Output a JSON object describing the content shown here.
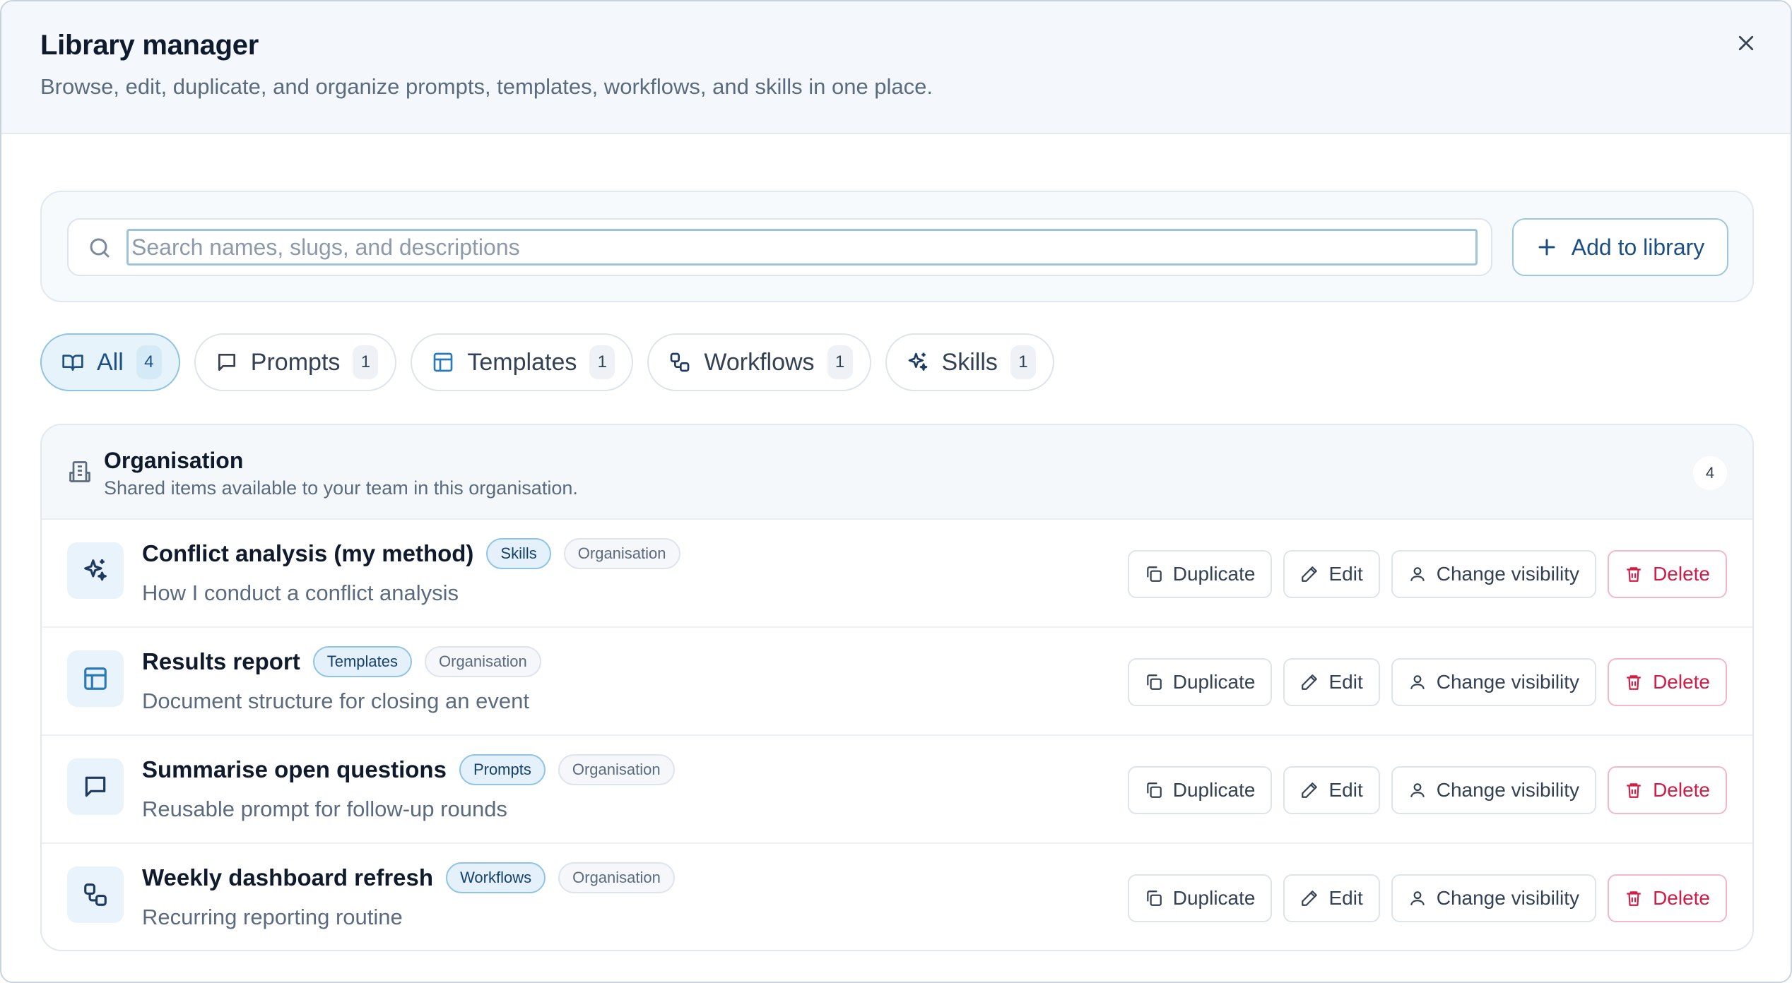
{
  "dialog": {
    "title": "Library manager",
    "subtitle": "Browse, edit, duplicate, and organize prompts, templates, workflows, and skills in one place."
  },
  "search": {
    "placeholder": "Search names, slugs, and descriptions",
    "value": ""
  },
  "add_button": {
    "label": "Add to library"
  },
  "tabs": [
    {
      "label": "All",
      "count": "4",
      "icon": "book-open-icon",
      "active": true
    },
    {
      "label": "Prompts",
      "count": "1",
      "icon": "message-square-icon",
      "active": false
    },
    {
      "label": "Templates",
      "count": "1",
      "icon": "layout-template-icon",
      "active": false
    },
    {
      "label": "Workflows",
      "count": "1",
      "icon": "workflow-icon",
      "active": false
    },
    {
      "label": "Skills",
      "count": "1",
      "icon": "sparkles-icon",
      "active": false
    }
  ],
  "group": {
    "title": "Organisation",
    "description": "Shared items available to your team in this organisation.",
    "count": "4",
    "icon": "building-icon"
  },
  "actions": {
    "duplicate": "Duplicate",
    "edit": "Edit",
    "visibility": "Change visibility",
    "delete": "Delete"
  },
  "items": [
    {
      "name": "Conflict analysis (my method)",
      "type": "Skills",
      "visibility": "Organisation",
      "description": "How I conduct a conflict analysis",
      "icon": "sparkles-icon"
    },
    {
      "name": "Results report",
      "type": "Templates",
      "visibility": "Organisation",
      "description": "Document structure for closing an event",
      "icon": "layout-template-icon"
    },
    {
      "name": "Summarise open questions",
      "type": "Prompts",
      "visibility": "Organisation",
      "description": "Reusable prompt for follow-up rounds",
      "icon": "message-square-icon"
    },
    {
      "name": "Weekly dashboard refresh",
      "type": "Workflows",
      "visibility": "Organisation",
      "description": "Recurring reporting routine",
      "icon": "workflow-icon"
    }
  ],
  "colors": {
    "accent": "#1b4f86",
    "danger": "#d21c46",
    "accent_bg": "#e7f3fb"
  }
}
